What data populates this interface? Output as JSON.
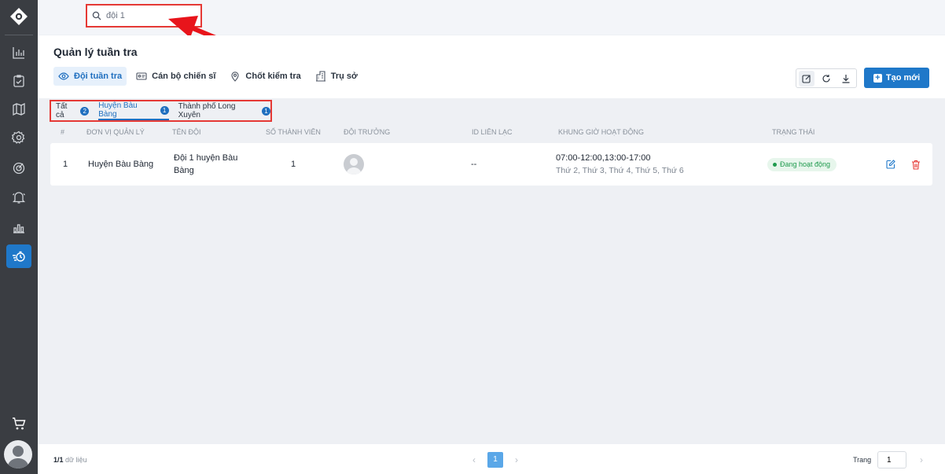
{
  "search": {
    "value": "đội 1",
    "placeholder": ""
  },
  "page": {
    "title": "Quản lý tuần tra"
  },
  "tabs": [
    {
      "label": "Đội tuần tra",
      "icon": "eye-icon",
      "active": true
    },
    {
      "label": "Cán bộ chiến sĩ",
      "icon": "id-card-icon",
      "active": false
    },
    {
      "label": "Chốt kiểm tra",
      "icon": "map-pin-icon",
      "active": false
    },
    {
      "label": "Trụ sở",
      "icon": "building-icon",
      "active": false
    }
  ],
  "toolbar": {
    "create_label": "Tạo mới"
  },
  "filters": [
    {
      "label": "Tất cả",
      "count": "2",
      "active": false
    },
    {
      "label": "Huyện Bàu Bàng",
      "count": "1",
      "active": true
    },
    {
      "label": "Thành phố Long Xuyên",
      "count": "1",
      "active": false
    }
  ],
  "table": {
    "headers": [
      "#",
      "ĐƠN VỊ QUẢN LÝ",
      "TÊN ĐỘI",
      "SỐ THÀNH VIÊN",
      "ĐỘI TRƯỞNG",
      "ID LIÊN LẠC",
      "KHUNG GIỜ HOẠT ĐỘNG",
      "TRẠNG THÁI"
    ],
    "rows": [
      {
        "index": "1",
        "unit": "Huyện Bàu Bàng",
        "team_line1": "Đội 1 huyện Bàu",
        "team_line2": "Bàng",
        "members": "1",
        "contact_id": "--",
        "hours": "07:00-12:00,13:00-17:00",
        "days": "Thứ 2, Thứ 3, Thứ 4, Thứ 5, Thứ 6",
        "status": "Đang hoạt động"
      }
    ]
  },
  "footer": {
    "count_bold": "1/1",
    "count_label": "dữ liệu",
    "current_page": "1",
    "goto_label": "Trang",
    "goto_value": "1"
  },
  "colors": {
    "accent": "#1f78c9",
    "sidebar": "#3a3d42",
    "highlight": "#e53935",
    "status_green": "#1f9a4d"
  }
}
